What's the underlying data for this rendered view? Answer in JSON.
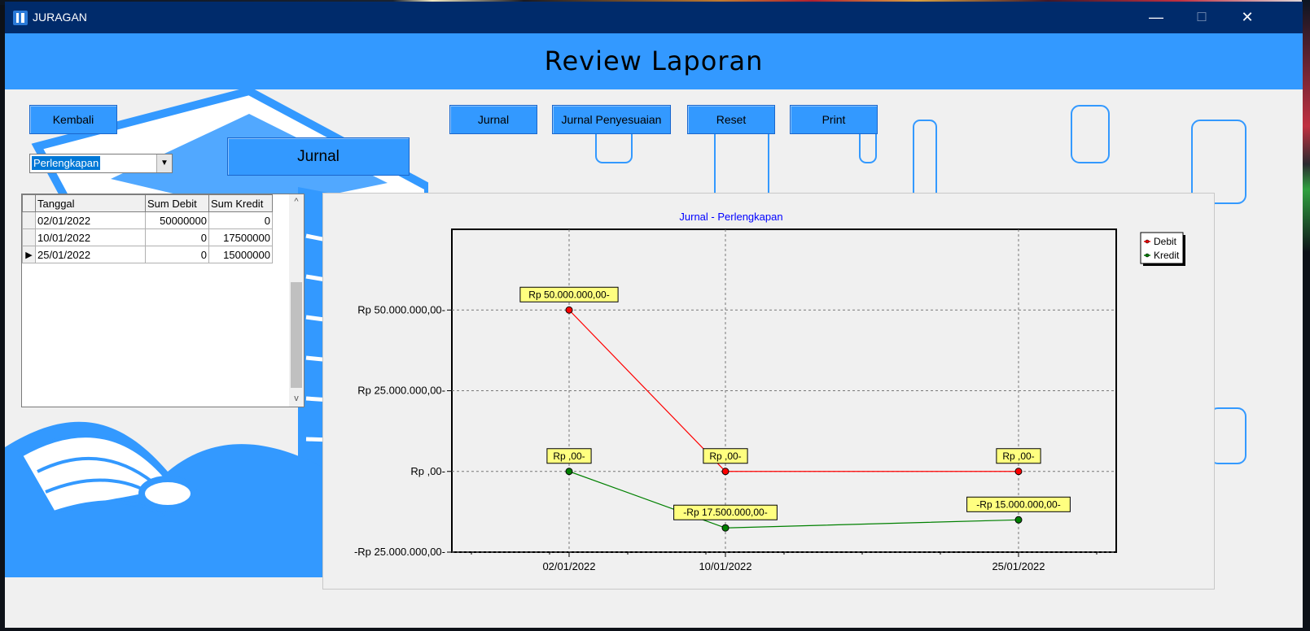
{
  "window": {
    "title": "JURAGAN",
    "minimize_glyph": "—",
    "maximize_glyph": "☐",
    "close_glyph": "✕"
  },
  "header": {
    "title": "Review Laporan"
  },
  "buttons": {
    "kembali": "Kembali",
    "jurnal": "Jurnal",
    "jurnal_penyesuaian": "Jurnal Penyesuaian",
    "reset": "Reset",
    "print": "Print",
    "jurnal_heading": "Jurnal"
  },
  "combo": {
    "selected": "Perlengkapan",
    "arrow": "▼"
  },
  "grid": {
    "columns": [
      "Tanggal",
      "Sum Debit",
      "Sum Kredit"
    ],
    "rows": [
      {
        "tanggal": "02/01/2022",
        "debit": "50000000",
        "kredit": "0",
        "current": false
      },
      {
        "tanggal": "10/01/2022",
        "debit": "0",
        "kredit": "17500000",
        "current": false
      },
      {
        "tanggal": "25/01/2022",
        "debit": "0",
        "kredit": "15000000",
        "current": true
      }
    ],
    "current_row_marker": "▶",
    "scroll_up": "^",
    "scroll_down": "v"
  },
  "colors": {
    "header_blue": "#3399ff",
    "titlebar": "#002b6b",
    "debit": "#ff0000",
    "kredit": "#008000",
    "label_bg": "#ffff80",
    "chart_title": "#0000ff"
  },
  "chart_data": {
    "type": "line",
    "title": "Jurnal - Perlengkapan",
    "x": [
      "02/01/2022",
      "10/01/2022",
      "25/01/2022"
    ],
    "x_days": [
      2,
      10,
      25
    ],
    "x_range_days": [
      -4,
      30
    ],
    "series": [
      {
        "name": "Debit",
        "color": "#ff0000",
        "values": [
          50000000,
          0,
          0
        ],
        "labels": [
          "Rp 50.000.000,00-",
          "Rp ,00-",
          "Rp ,00-"
        ]
      },
      {
        "name": "Kredit",
        "color": "#008000",
        "values": [
          0,
          -17500000,
          -15000000
        ],
        "labels": [
          "Rp ,00-",
          "-Rp 17.500.000,00-",
          "-Rp 15.000.000,00-"
        ]
      }
    ],
    "yticks": [
      {
        "value": 50000000,
        "label": "Rp 50.000.000,00-"
      },
      {
        "value": 25000000,
        "label": "Rp 25.000.000,00-"
      },
      {
        "value": 0,
        "label": "Rp ,00-"
      },
      {
        "value": -25000000,
        "label": "-Rp 25.000.000,00-"
      }
    ],
    "ylim": [
      -25000000,
      75000000
    ],
    "grid": true,
    "legend_position": "top-right"
  }
}
